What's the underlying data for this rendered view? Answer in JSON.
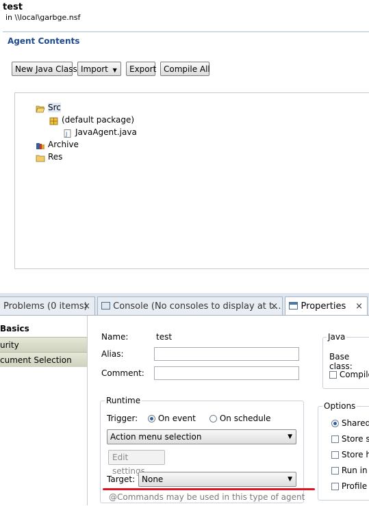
{
  "header": {
    "title": "test",
    "subtitle": "in \\\\local\\garbge.nsf"
  },
  "agent_contents": {
    "title": "Agent Contents"
  },
  "toolbar": {
    "new_java_class": "New Java Class",
    "import": "Import",
    "export": "Export",
    "compile_all": "Compile All"
  },
  "tree": {
    "items": [
      {
        "label": "Src",
        "icon": "folder-open-icon"
      },
      {
        "label": "(default package)",
        "icon": "package-icon"
      },
      {
        "label": "JavaAgent.java",
        "icon": "java-file-icon"
      },
      {
        "label": "Archive",
        "icon": "archive-icon"
      },
      {
        "label": "Res",
        "icon": "folder-icon"
      }
    ]
  },
  "tabs": [
    {
      "label": "Problems (0 items)",
      "close": "×"
    },
    {
      "label": "Console (No consoles to display at t...",
      "close": "×"
    },
    {
      "label": "Properties",
      "close": "×"
    }
  ],
  "nav": {
    "items": [
      {
        "label": "Basics"
      },
      {
        "label": "urity"
      },
      {
        "label": "cument Selection"
      }
    ]
  },
  "basics": {
    "name_label": "Name:",
    "name_value": "test",
    "alias_label": "Alias:",
    "alias_value": "",
    "comment_label": "Comment:",
    "comment_value": ""
  },
  "runtime": {
    "title": "Runtime",
    "trigger_label": "Trigger:",
    "on_event": "On event",
    "on_schedule": "On schedule",
    "event_select": "Action menu selection",
    "edit_settings": "Edit settings...",
    "target_label": "Target:",
    "target_select": "None",
    "hint": "@Commands may be used in this type of agent"
  },
  "java": {
    "title": "Java",
    "base_class_label": "Base class:",
    "compile_label": "Compile"
  },
  "options": {
    "title": "Options",
    "shared": "Shared",
    "store_se": "Store se",
    "store_hi": "Store hi",
    "run_in": "Run in I",
    "profile": "Profile t"
  },
  "colors": {
    "accent": "#1f4a8f",
    "highlight_line": "#e0141f"
  }
}
